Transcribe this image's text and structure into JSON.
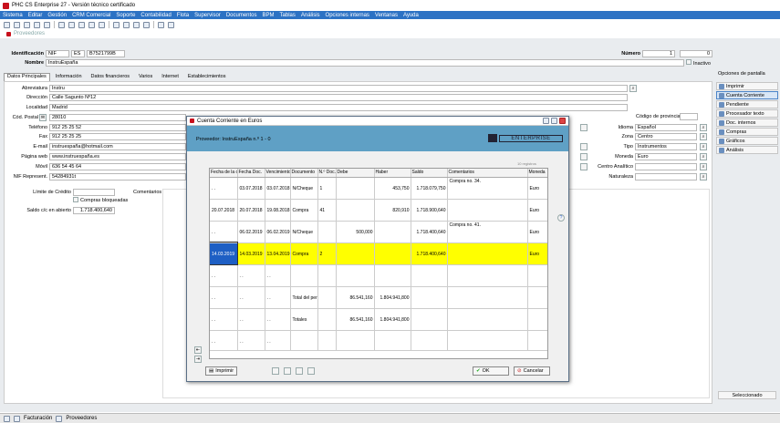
{
  "app": {
    "title": "PHC CS Enterprise 27 - Versión técnico certificado"
  },
  "menu": [
    "Sistema",
    "Editar",
    "Gestión",
    "CRM Comercial",
    "Soporte",
    "Contabilidad",
    "Flota",
    "Supervisor",
    "Documentos",
    "BPM",
    "Tablas",
    "Análisis",
    "Opciones internas",
    "Ventanas",
    "Ayuda"
  ],
  "doc": {
    "title": "Proveedores"
  },
  "header": {
    "ident_label": "Identificación",
    "ident_type": "NIF",
    "country": "ES",
    "nif": "B7521799B",
    "numero_label": "Número",
    "numero": "1",
    "numero2": "0",
    "nombre_label": "Nombre",
    "nombre": "InstruEspaña",
    "inactivo": "Inactivo",
    "opciones": "Opciones de pantalla"
  },
  "tabs": [
    "Datos Principales",
    "Información",
    "Datos financieros",
    "Varios",
    "Internet",
    "Establecimientos"
  ],
  "form": {
    "abreviatura_label": "Abreviatura",
    "abreviatura": "Instru",
    "direccion_label": "Dirección",
    "direccion": "Calle Sagunto Nº12",
    "localidad_label": "Localidad",
    "localidad": "Madrid",
    "cp_label": "Cód. Postal",
    "cp": "28010",
    "telefono_label": "Teléfono",
    "telefono": "912 25 25 52",
    "fax_label": "Fax",
    "fax": "912 25 25 25",
    "email_label": "E-mail",
    "email": "instruespaña@hotmail.com",
    "web_label": "Página web",
    "web": "www.instruespaña.es",
    "movil_label": "Móvil",
    "movil": "636 54 45 64",
    "nifrep_label": "NIF Represent.",
    "nifrep": "54284931t",
    "limite_label": "Límite de Crédito",
    "compras_bloq": "Compras bloqueadas",
    "saldo_label": "Saldo c/c en abierto",
    "saldo": "1.718.400,640",
    "comentarios_label": "Comentarios",
    "codprov_label": "Código de provincia",
    "idioma_label": "Idioma",
    "idioma": "Español",
    "zona_label": "Zona",
    "zona": "Centro",
    "tipo_label": "Tipo",
    "tipo": "Instrumentos",
    "moneda_label": "Moneda",
    "moneda": "Euro",
    "centro_label": "Centro Analítico",
    "naturaleza_label": "Naturaleza"
  },
  "side": {
    "items": [
      "Imprimir",
      "Cuenta Corriente",
      "Pendiente",
      "Procesador texto",
      "Doc. internos",
      "Compras",
      "Gráficos",
      "Análisis"
    ],
    "seleccionado": "Seleccionado"
  },
  "status": {
    "items": [
      "Facturación",
      "Proveedores"
    ]
  },
  "modal": {
    "title": "Cuenta Corriente en Euros",
    "provider": "Proveedor: InstruEspaña n.º 1 - 0",
    "logo_text": "ENTERPRISE",
    "registros": "10 registros",
    "columns": [
      "Fecha de la c",
      "Fecha Doc.",
      "Vencimiento",
      "Documento",
      "N.º Doc.",
      "Debe",
      "Haber",
      "Saldo",
      "Comentarios",
      "Moneda"
    ],
    "rows": [
      {
        "c": [
          ". .",
          "03.07.2018",
          "03.07.2018",
          "N/Cheque",
          "1",
          "",
          "453,750",
          "1.718.079,750",
          "Compra no. 34.",
          "Euro"
        ]
      },
      {
        "c": [
          "20.07.2018",
          "20.07.2018",
          "19.08.2018",
          "Compra",
          "41",
          "",
          "820,910",
          "1.718.900,640",
          "",
          "Euro"
        ]
      },
      {
        "c": [
          ". .",
          "06.02.2019",
          "06.02.2019",
          "N/Cheque",
          "",
          "500,000",
          "",
          "1.718.400,640",
          "Compra no. 41.",
          "Euro"
        ]
      },
      {
        "c": [
          "14.03.2019",
          "14.03.2019",
          "13.04.2019",
          "Compra",
          "2",
          "",
          "",
          "1.718.400,640",
          "",
          "Euro"
        ],
        "hl": true
      },
      {
        "c": [
          ". .",
          ". .",
          ". .",
          "",
          "",
          "",
          "",
          "",
          "",
          ""
        ]
      },
      {
        "c": [
          ". .",
          ". .",
          ". .",
          "Total del per",
          "",
          "86.541,160",
          "1.804.941,800",
          "",
          "",
          ""
        ]
      },
      {
        "c": [
          ". .",
          ". .",
          ". .",
          "Totales",
          "",
          "86.541,160",
          "1.804.941,800",
          "",
          "",
          ""
        ]
      },
      {
        "c": [
          ". .",
          ". .",
          ". .",
          "",
          "",
          "",
          "",
          "",
          "",
          ""
        ]
      }
    ],
    "print": "Imprimir",
    "ok": "OK",
    "cancel": "Cancelar"
  }
}
